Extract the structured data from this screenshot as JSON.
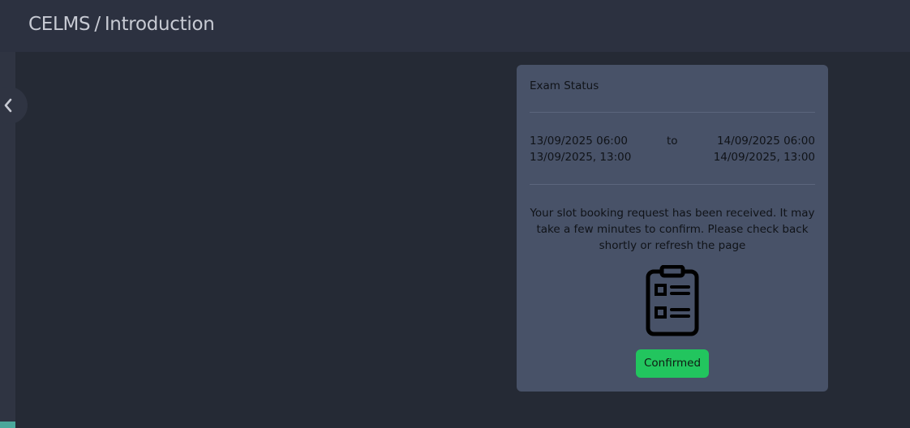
{
  "header": {
    "breadcrumb_root": "CELMS",
    "breadcrumb_separator": "/",
    "breadcrumb_current": "Introduction"
  },
  "sidebar": {
    "toggle_icon": "chevron-left-icon"
  },
  "exam_card": {
    "title": "Exam Status",
    "start_datetime": "13/09/2025 06:00",
    "start_datetime_local": "13/09/2025, 13:00",
    "separator": "to",
    "end_datetime": "14/09/2025 06:00",
    "end_datetime_local": "14/09/2025, 13:00",
    "message": "Your slot booking request has been received. It may take a few minutes to confirm. Please check back shortly or refresh the page",
    "icon": "clipboard-checklist-icon",
    "status": "Confirmed",
    "status_color": "#22c55e"
  }
}
